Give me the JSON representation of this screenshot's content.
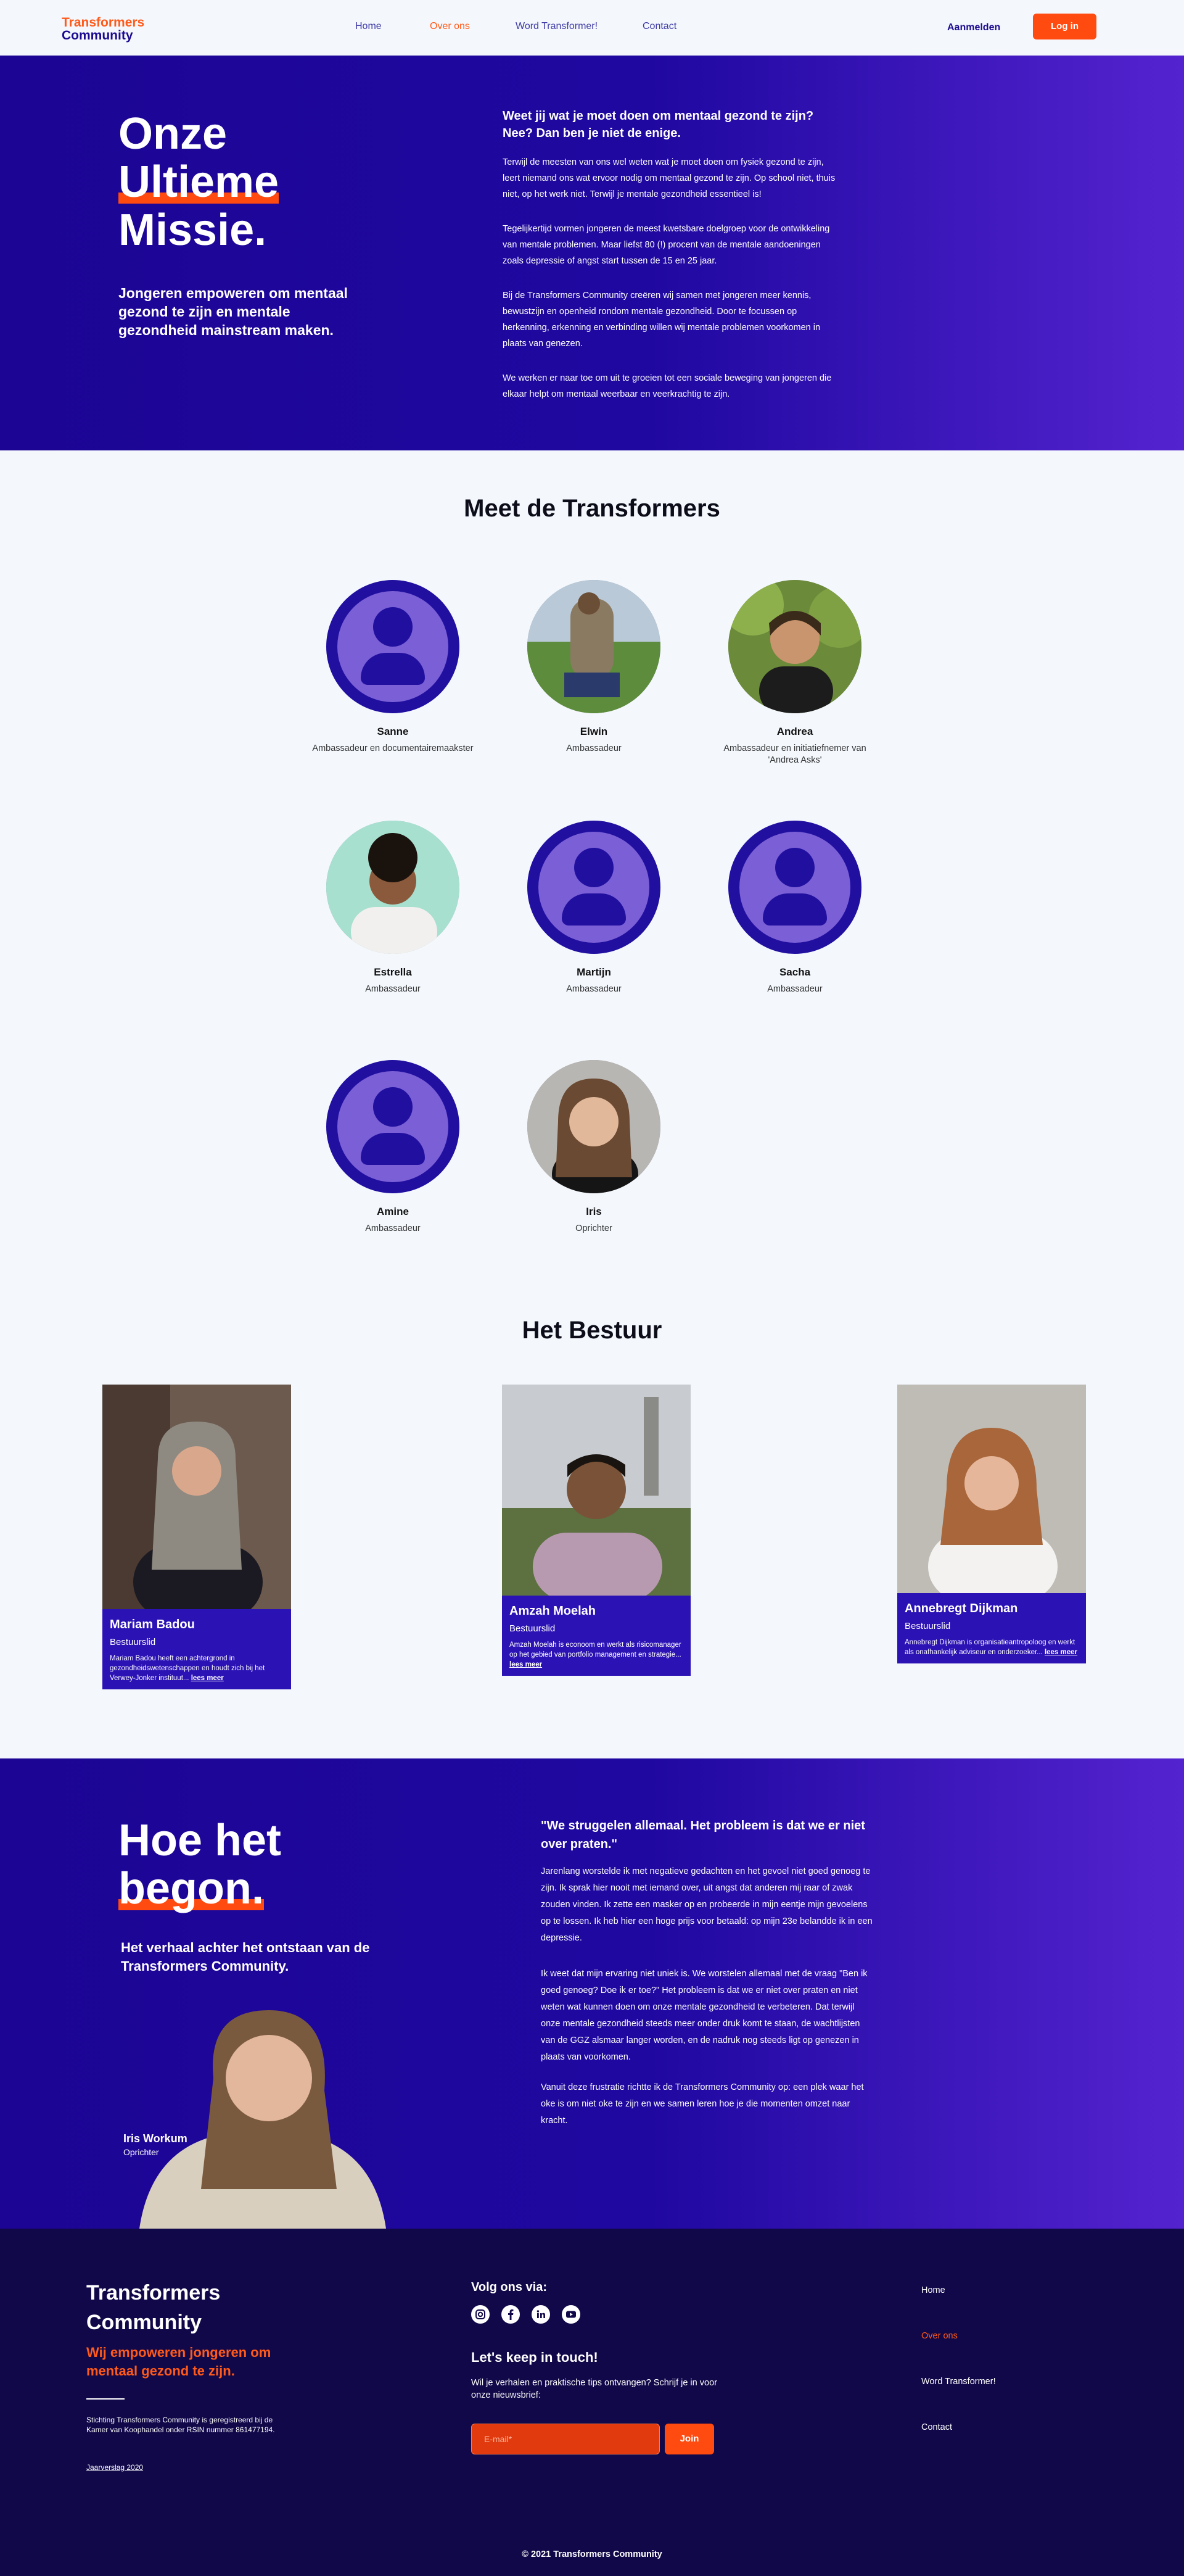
{
  "header": {
    "logo_line1": "Transformers",
    "logo_line2": "Community",
    "nav": [
      "Home",
      "Over ons",
      "Word Transformer!",
      "Contact"
    ],
    "active_nav": "Over ons",
    "signup_label": "Aanmelden",
    "login_label": "Log in"
  },
  "hero": {
    "title_line1": "Onze",
    "title_line2": "Ultieme",
    "title_line3": "Missie.",
    "subtitle": "Jongeren empoweren om mentaal gezond te zijn en mentale gezondheid mainstream maken.",
    "question": "Weet jij wat je moet doen om mentaal gezond te zijn? Nee? Dan ben je niet de enige.",
    "paragraphs": [
      "Terwijl de meesten van ons wel weten wat je moet doen om fysiek gezond te zijn, leert niemand ons wat ervoor nodig om mentaal gezond te zijn. Op school niet, thuis niet, op het werk niet. Terwijl je mentale gezondheid essentieel is!",
      "Tegelijkertijd vormen jongeren de meest kwetsbare doelgroep voor de ontwikkeling van mentale problemen. Maar liefst 80 (!) procent van de mentale aandoeningen zoals depressie of angst start tussen de 15 en 25 jaar.",
      "Bij de Transformers Community creëren wij samen met jongeren meer kennis, bewustzijn en openheid rondom mentale gezondheid. Door te focussen op herkenning, erkenning en verbinding willen wij mentale problemen voorkomen in plaats van genezen.",
      "We werken er naar toe om uit te groeien tot een sociale beweging van jongeren die elkaar helpt om mentaal weerbaar en veerkrachtig te zijn."
    ]
  },
  "team": {
    "title": "Meet de Transformers",
    "members": [
      {
        "name": "Sanne",
        "role": "Ambassadeur en documentairemaakster"
      },
      {
        "name": "Elwin",
        "role": "Ambassadeur"
      },
      {
        "name": "Andrea",
        "role": "Ambassadeur en initiatiefnemer van 'Andrea Asks'"
      },
      {
        "name": "Estrella",
        "role": "Ambassadeur"
      },
      {
        "name": "Martijn",
        "role": "Ambassadeur"
      },
      {
        "name": "Sacha",
        "role": "Ambassadeur"
      },
      {
        "name": "Amine",
        "role": "Ambassadeur"
      },
      {
        "name": "Iris",
        "role": "Oprichter"
      }
    ]
  },
  "board": {
    "title": "Het Bestuur",
    "members": [
      {
        "name": "Mariam Badou",
        "role": "Bestuurslid",
        "desc": "Mariam Badou heeft een achtergrond in gezondheidswetenschappen en houdt zich bij het Verwey-Jonker instituut...",
        "more": "lees meer"
      },
      {
        "name": "Amzah Moelah",
        "role": "Bestuurslid",
        "desc": "Amzah Moelah is econoom en werkt als risicomanager op het gebied van portfolio management en strategie...",
        "more": "lees meer"
      },
      {
        "name": "Annebregt Dijkman",
        "role": "Bestuurslid",
        "desc": "Annebregt Dijkman is organisatieantropoloog en werkt als onafhankelijk adviseur en onderzoeker...",
        "more": "lees meer"
      }
    ]
  },
  "story": {
    "title_line1": "Hoe het",
    "title_line2": "begon.",
    "subtitle": "Het verhaal achter het ontstaan van de Transformers Community.",
    "founder_name": "Iris Workum",
    "founder_role": "Oprichter",
    "quote": "\"We struggelen allemaal. Het probleem is dat we er niet over praten.\"",
    "paragraphs": [
      "Jarenlang worstelde ik met negatieve gedachten en het gevoel niet goed genoeg te zijn. Ik sprak hier nooit met iemand over, uit angst dat anderen mij raar of zwak zouden vinden. Ik zette een masker op en probeerde in mijn eentje mijn gevoelens op te lossen. Ik heb hier een hoge prijs voor betaald: op mijn 23e belandde ik in een depressie.",
      "Ik weet dat mijn ervaring niet uniek is. We worstelen allemaal met de vraag \"Ben ik goed genoeg? Doe ik er toe?\" Het probleem is dat we er niet over praten en niet weten wat kunnen doen om onze mentale gezondheid te verbeteren. Dat terwijl onze mentale gezondheid steeds meer onder druk komt te staan, de wachtlijsten van de GGZ alsmaar langer worden, en de nadruk nog steeds ligt op genezen in plaats van voorkomen.",
      "Vanuit deze frustratie richtte ik de Transformers Community op: een plek waar het oke is om niet oke te zijn en we samen leren hoe je die momenten omzet naar kracht."
    ]
  },
  "footer": {
    "brand_line1": "Transformers",
    "brand_line2": "Community",
    "tagline": "Wij empoweren jongeren om mentaal gezond te zijn.",
    "legal": "Stichting Transformers Community is geregistreerd bij de Kamer van Koophandel onder RSIN nummer 861477194.",
    "report": "Jaarverslag 2020",
    "follow": "Volg ons via:",
    "keep_title": "Let's keep in touch!",
    "keep_text": "Wil je verhalen en praktische tips ontvangen? Schrijf je in voor onze nieuwsbrief:",
    "email_placeholder": "E-mail*",
    "join_label": "Join",
    "nav": [
      "Home",
      "Over ons",
      "Word Transformer!",
      "Contact"
    ],
    "copyright": "© 2021 Transformers Community"
  },
  "colors": {
    "brand_blue": "#1d0a8f",
    "accent_orange": "#ff4a10",
    "footer_bg": "#110849"
  }
}
